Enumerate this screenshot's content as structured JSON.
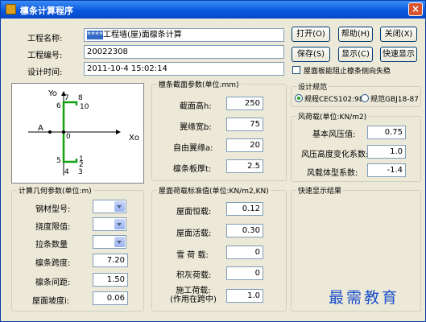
{
  "window": {
    "title": "檩条计算程序",
    "close_glyph": "×"
  },
  "project": {
    "name_label": "工程名称:",
    "name_selected": "****",
    "name_rest": "工程墙(屋)面檩条计算",
    "number_label": "工程编号:",
    "number_value": "20022308",
    "time_label": "设计时间:",
    "time_value": "2011-10-4 15:02:14"
  },
  "buttons": {
    "open": "打开(O)",
    "help": "帮助(H)",
    "close": "关闭(X)",
    "save": "保存(S)",
    "display": "显示(C)",
    "quick": "快速显示"
  },
  "checkbox_label": "屋面板能阻止檩条侧向失稳",
  "diagram": {
    "y_axis": "Yo",
    "x_axis": "Xo",
    "origin": "0",
    "point_a": "A",
    "pts": [
      "7",
      "8",
      "6",
      "10",
      "5",
      "4",
      "3",
      "1",
      "2"
    ]
  },
  "section": {
    "title": "檩条截面参数(单位:mm)",
    "height_label": "截面高h:",
    "height_value": "250",
    "flange_label": "翼缘宽b:",
    "flange_value": "75",
    "lip_label": "自由翼缘a:",
    "lip_value": "20",
    "thick_label": "檩条板厚t:",
    "thick_value": "2.5"
  },
  "code": {
    "title": "设计规范",
    "opt1": "规程CECS102:98",
    "opt2": "规范GBJ18-87"
  },
  "wind": {
    "title": "风荷载(单位:KN/m2)",
    "basic_label": "基本风压值:",
    "basic_value": "0.75",
    "height_label": "风压高度变化系数:",
    "height_value": "1.0",
    "shape_label": "风载体型系数:",
    "shape_value": "-1.4"
  },
  "calc": {
    "title": "计算几何参数(单位:m)",
    "steel_label": "钢材型号:",
    "deflect_label": "挠度限值:",
    "tie_label": "拉条数量",
    "span_label": "檩条跨度:",
    "span_value": "7.20",
    "spacing_label": "檩条间距:",
    "spacing_value": "1.50",
    "slope_label": "屋面坡度i:",
    "slope_value": "0.06"
  },
  "loads": {
    "title": "屋面荷载标准值(单位:KN/m2,KN)",
    "dead_label": "屋面恒载:",
    "dead_value": "0.12",
    "live_label": "屋面活载:",
    "live_value": "0.30",
    "snow_label": "雪 荷 载:",
    "snow_value": "0",
    "ash_label": "积灰荷载:",
    "ash_value": "0",
    "const_label_1": "施工荷载:",
    "const_label_2": "(作用在跨中)",
    "const_value": "1.0"
  },
  "quick_results": {
    "title": "快速显示结果"
  },
  "watermark": "最需教育"
}
